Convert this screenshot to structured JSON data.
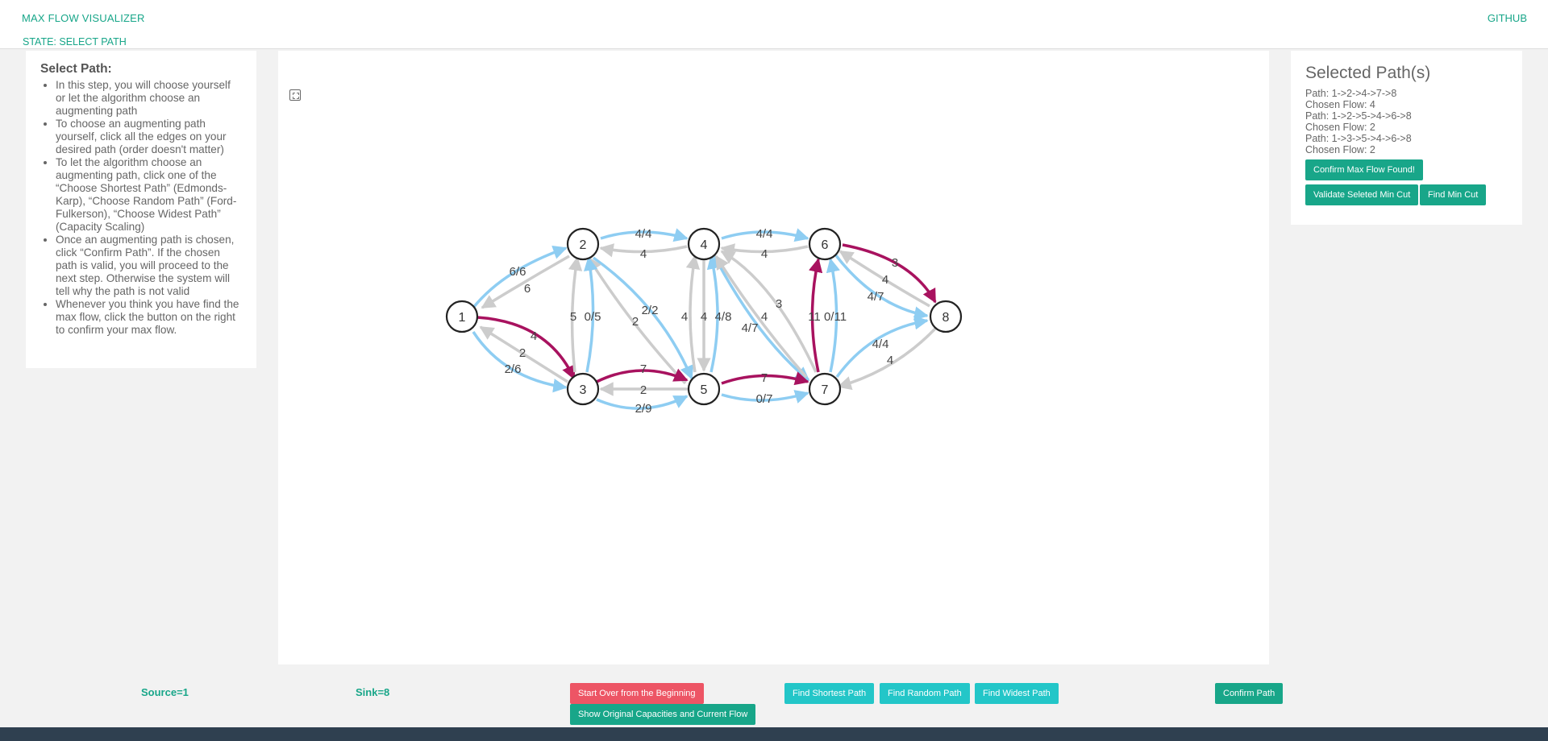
{
  "header": {
    "brand": "MAX FLOW VISUALIZER",
    "github": "GITHUB",
    "state": "STATE: SELECT PATH"
  },
  "instructions": {
    "title": "Select Path:",
    "items": [
      "In this step, you will choose yourself or let the algorithm choose an augmenting path",
      "To choose an augmenting path yourself, click all the edges on your desired path (order doesn't matter)",
      "To let the algorithm choose an augmenting path, click one of the “Choose Shortest Path” (Edmonds-Karp), “Choose Random Path” (Ford-Fulkerson), “Choose Widest Path” (Capacity Scaling)",
      "Once an augmenting path is chosen, click “Confirm Path”. If the chosen path is valid, you will proceed to the next step. Otherwise the system will tell why the path is not valid",
      "Whenever you think you have find the max flow, click the button on the right to confirm your max flow."
    ]
  },
  "selected": {
    "title": "Selected Path(s)",
    "lines": [
      "Path: 1->2->4->7->8",
      "Chosen Flow: 4",
      "Path: 1->2->5->4->6->8",
      "Chosen Flow: 2",
      "Path: 1->3->5->4->6->8",
      "Chosen Flow: 2"
    ],
    "confirm_max_flow": "Confirm Max Flow Found!",
    "validate_min_cut": "Validate Seleted Min Cut",
    "find_min_cut": "Find Min Cut"
  },
  "bottom": {
    "source": "Source=1",
    "sink": "Sink=8",
    "start_over": "Start Over from the Beginning",
    "show_original": "Show Original Capacities and Current Flow",
    "find_shortest": "Find Shortest Path",
    "find_random": "Find Random Path",
    "find_widest": "Find Widest Path",
    "confirm_path": "Confirm Path"
  },
  "graph": {
    "colors": {
      "flow": "#8ecdf2",
      "residual": "#cccccc",
      "selected": "#a8125f",
      "node_border": "#222222"
    },
    "nodes": [
      "1",
      "2",
      "3",
      "4",
      "5",
      "6",
      "7",
      "8"
    ],
    "edge_labels": {
      "e12_flow": "6/6",
      "e21_res": "6",
      "e13_flow": "2/6",
      "e31_res": "2",
      "e13_sel": "4",
      "e24_flow": "4/4",
      "e42_res": "4",
      "e25_flow": "2/2",
      "e52_res": "2",
      "e32_res": "5",
      "e32_flow": "0/5",
      "e35_flow": "2/9",
      "e53_res": "2",
      "e35_sel": "7",
      "e54_res": "4",
      "e45_res": "4",
      "e54_flow": "4/8",
      "e46_flow": "4/4",
      "e64_res": "4",
      "e47_flow": "4/7",
      "e74_res": "4",
      "e74_res2": "3",
      "e57_flow": "0/7",
      "e57_sel": "7",
      "e76_sel": "11",
      "e76_flow": "0/11",
      "e68_flow": "4/7",
      "e86_res": "4",
      "e68_sel": "3",
      "e78_flow": "4/4",
      "e87_res": "4"
    }
  }
}
